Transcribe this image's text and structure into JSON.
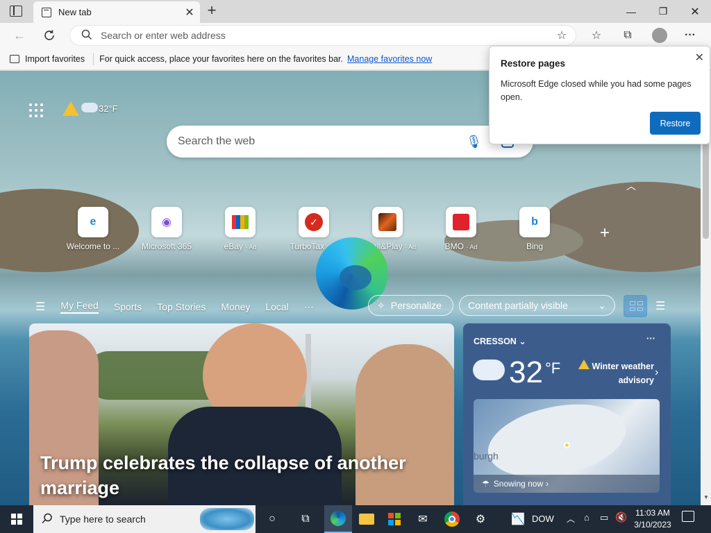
{
  "browser": {
    "tab_title": "New tab",
    "address_placeholder": "Search or enter web address"
  },
  "favorites_bar": {
    "import_label": "Import favorites",
    "message": "For quick access, place your favorites here on the favorites bar.",
    "manage_link": "Manage favorites now"
  },
  "new_tab": {
    "weather_temp": "32°F",
    "search_placeholder": "Search the web",
    "quick_links": [
      {
        "label": "Welcome to ...",
        "ad": ""
      },
      {
        "label": "Microsoft 365",
        "ad": ""
      },
      {
        "label": "eBay",
        "ad": "· Ad"
      },
      {
        "label": "TurboTax",
        "ad": "· Ad"
      },
      {
        "label": "Install&Play",
        "ad": "· Ad"
      },
      {
        "label": "BMO",
        "ad": "· Ad"
      },
      {
        "label": "Bing",
        "ad": ""
      }
    ],
    "feed_tabs": [
      "My Feed",
      "Sports",
      "Top Stories",
      "Money",
      "Local"
    ],
    "more_label": "···",
    "personalize_label": "Personalize",
    "content_visibility": "Content partially visible",
    "news": {
      "headline": "Trump celebrates the collapse of another marriage"
    },
    "weather_card": {
      "location": "CRESSON",
      "temperature": "32",
      "unit": "°F",
      "alert": "Winter weather advisory",
      "map_label": "burgh",
      "status": "Snowing now"
    }
  },
  "restore_popup": {
    "title": "Restore pages",
    "message": "Microsoft Edge closed while you had some pages open.",
    "button": "Restore"
  },
  "taskbar": {
    "search_placeholder": "Type here to search",
    "stock_label": "DOW",
    "time": "11:03 AM",
    "date": "3/10/2023"
  },
  "colors": {
    "accent": "#0f6cbd",
    "taskbar": "#1f2a36"
  }
}
